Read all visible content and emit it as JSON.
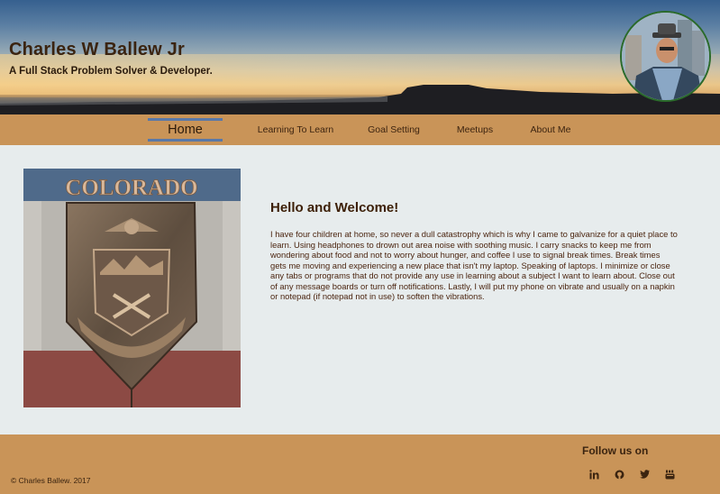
{
  "header": {
    "title": "Charles W Ballew Jr",
    "subtitle": "A Full Stack Problem Solver & Developer."
  },
  "nav": {
    "items": [
      {
        "label": "Home",
        "active": true
      },
      {
        "label": "Learning To Learn",
        "active": false
      },
      {
        "label": "Goal Setting",
        "active": false
      },
      {
        "label": "Meetups",
        "active": false
      },
      {
        "label": "About Me",
        "active": false
      }
    ]
  },
  "main": {
    "image_text": "COLORADO",
    "heading": "Hello and Welcome!",
    "body": "I have four children at home, so never a dull catastrophy which is why I came to galvanize for a quiet place to learn. Using headphones to drown out area noise with soothing music. I carry snacks to keep me from wondering about food and not to worry about hunger, and coffee I use to signal break times. Break times gets me moving and experiencing a new place that isn't my laptop. Speaking of laptops. I minimize or close any tabs or programs that do not provide any use in learning about a subject I want to learn about. Close out of any message boards or turn off notifications. Lastly, I will put my phone on vibrate and usually on a napkin or notepad (if notepad not in use) to soften the vibrations."
  },
  "footer": {
    "copyright": "© Charles Ballew. 2017",
    "follow_label": "Follow us on",
    "social_icons": [
      "linkedin-icon",
      "github-icon",
      "twitter-icon",
      "youtube-icon"
    ]
  },
  "colors": {
    "nav_bg": "#c99458",
    "page_bg": "#e7eced",
    "active_border": "#5978a8",
    "text_brown": "#4a2a10"
  }
}
